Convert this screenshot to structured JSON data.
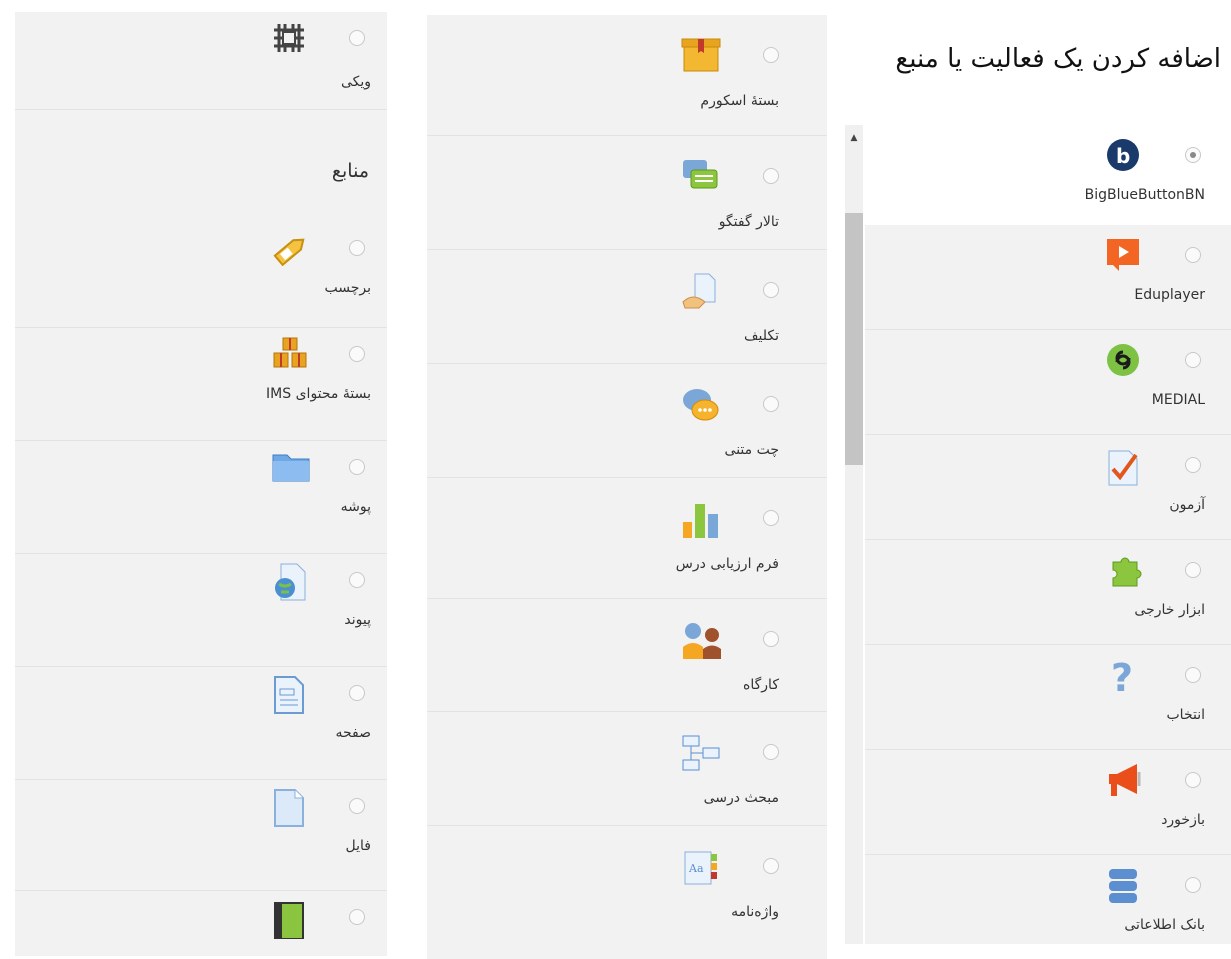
{
  "page_title": "اضافه کردن یک فعالیت یا منبع",
  "left_column": {
    "top_item": {
      "label": "ویکی",
      "icon": "wiki-icon"
    },
    "section_heading": "منابع",
    "items": [
      {
        "label": "برچسب",
        "icon": "label-tag-icon"
      },
      {
        "label": "بستهٔ محتوای IMS",
        "icon": "ims-package-icon"
      },
      {
        "label": "پوشه",
        "icon": "folder-icon"
      },
      {
        "label": "پیوند",
        "icon": "url-link-icon"
      },
      {
        "label": "صفحه",
        "icon": "page-icon"
      },
      {
        "label": "فایل",
        "icon": "file-icon"
      },
      {
        "label": "",
        "icon": "book-icon"
      }
    ]
  },
  "middle_column": {
    "items": [
      {
        "label": "بستهٔ اسکورم",
        "icon": "scorm-package-icon"
      },
      {
        "label": "تالار گفتگو",
        "icon": "forum-icon"
      },
      {
        "label": "تکلیف",
        "icon": "assignment-icon"
      },
      {
        "label": "چت متنی",
        "icon": "chat-icon"
      },
      {
        "label": "فرم ارزیابی درس",
        "icon": "survey-chart-icon"
      },
      {
        "label": "کارگاه",
        "icon": "workshop-icon"
      },
      {
        "label": "مبحث درسی",
        "icon": "lesson-icon"
      },
      {
        "label": "واژه‌نامه",
        "icon": "glossary-icon"
      }
    ]
  },
  "right_column": {
    "items": [
      {
        "label": "BigBlueButtonBN",
        "icon": "bigbluebutton-icon",
        "selected": true
      },
      {
        "label": "Eduplayer",
        "icon": "eduplayer-icon"
      },
      {
        "label": "MEDIAL",
        "icon": "medial-icon"
      },
      {
        "label": "آزمون",
        "icon": "quiz-icon"
      },
      {
        "label": "ابزار خارجی",
        "icon": "external-tool-puzzle-icon"
      },
      {
        "label": "انتخاب",
        "icon": "choice-question-icon"
      },
      {
        "label": "بازخورد",
        "icon": "feedback-megaphone-icon"
      },
      {
        "label": "بانک اطلاعاتی",
        "icon": "database-icon"
      }
    ]
  },
  "scrollbar": {
    "up_arrow": "▲"
  }
}
